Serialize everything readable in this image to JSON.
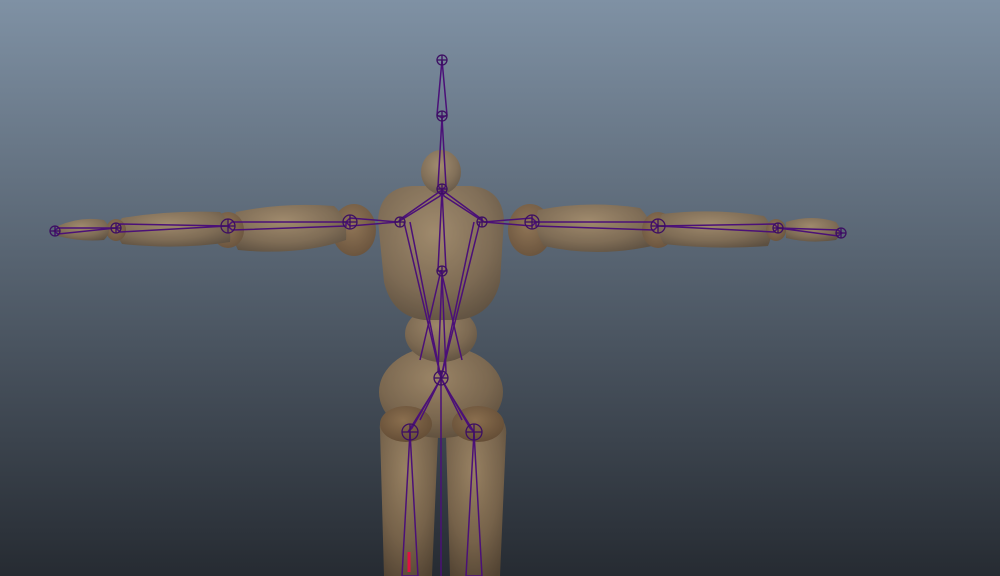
{
  "viewport": {
    "background_top": "#7f91a4",
    "background_bottom": "#262b32"
  },
  "model": {
    "body_color": "#8a6f4e",
    "joint_tint": "#7a5530",
    "bone_color": "#4b1078",
    "joint_outline": "#3d0f63",
    "selected_highlight": "#e01040"
  }
}
